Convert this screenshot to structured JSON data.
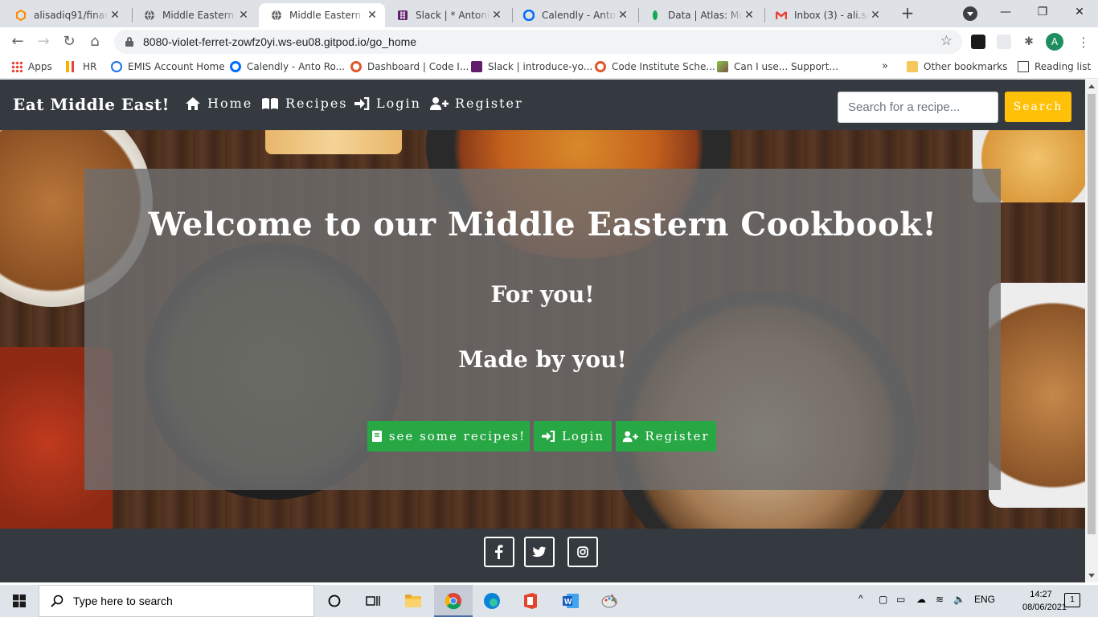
{
  "browser": {
    "tabs": [
      {
        "title": "alisadiq91/financ",
        "favicon": "gitpod-icon",
        "color": "#ff8a00"
      },
      {
        "title": "Middle Eastern C",
        "favicon": "globe-icon",
        "color": "#5f6368"
      },
      {
        "title": "Middle Eastern C",
        "favicon": "globe-icon",
        "color": "#5f6368",
        "active": true
      },
      {
        "title": "Slack | * AntonioR",
        "favicon": "slack-icon",
        "color": "#611f69"
      },
      {
        "title": "Calendly - Anto R",
        "favicon": "calendly-icon",
        "color": "#006bff"
      },
      {
        "title": "Data | Atlas: Mon",
        "favicon": "mongodb-leaf-icon",
        "color": "#13aa52"
      },
      {
        "title": "Inbox (3) - ali.sad",
        "favicon": "gmail-icon",
        "color": "#ea4335"
      }
    ],
    "url": "8080-violet-ferret-zowfz0yi.ws-eu08.gitpod.io/go_home",
    "profile_initial": "A",
    "bookmarks": [
      {
        "label": "Apps",
        "icon": "apps-grid-icon"
      },
      {
        "label": "HR",
        "icon": "chart-icon"
      },
      {
        "label": "EMIS Account Home",
        "icon": "emis-icon"
      },
      {
        "label": "Calendly - Anto Ro...",
        "icon": "calendly-icon"
      },
      {
        "label": "Dashboard | Code I...",
        "icon": "code-institute-icon"
      },
      {
        "label": "Slack | introduce-yo...",
        "icon": "slack-icon"
      },
      {
        "label": "Code Institute Sche...",
        "icon": "code-institute-icon"
      },
      {
        "label": "Can I use... Support...",
        "icon": "caniuse-icon"
      }
    ],
    "other_bookmarks": "Other bookmarks",
    "reading_list": "Reading list"
  },
  "site": {
    "brand": "Eat Middle East!",
    "nav": [
      {
        "label": "Home",
        "icon": "home-icon"
      },
      {
        "label": "Recipes",
        "icon": "book-open-icon"
      },
      {
        "label": "Login",
        "icon": "sign-in-icon"
      },
      {
        "label": "Register",
        "icon": "user-plus-icon"
      }
    ],
    "search_placeholder": "Search for a recipe...",
    "search_button": "Search",
    "hero": {
      "title": "Welcome to our Middle Eastern Cookbook!",
      "line1": "For you!",
      "line2": "Made by you!",
      "buttons": [
        {
          "label": "see some recipes!",
          "icon": "book-icon"
        },
        {
          "label": "Login",
          "icon": "sign-in-icon"
        },
        {
          "label": "Register",
          "icon": "user-plus-icon"
        }
      ]
    },
    "social": [
      "facebook-icon",
      "twitter-icon",
      "instagram-icon"
    ],
    "colors": {
      "navbar": "#343a40",
      "search_btn": "#ffc107",
      "cta": "#28a745"
    }
  },
  "taskbar": {
    "search_placeholder": "Type here to search",
    "language": "ENG",
    "time": "14:27",
    "date": "08/06/2021",
    "notifications": "1"
  }
}
